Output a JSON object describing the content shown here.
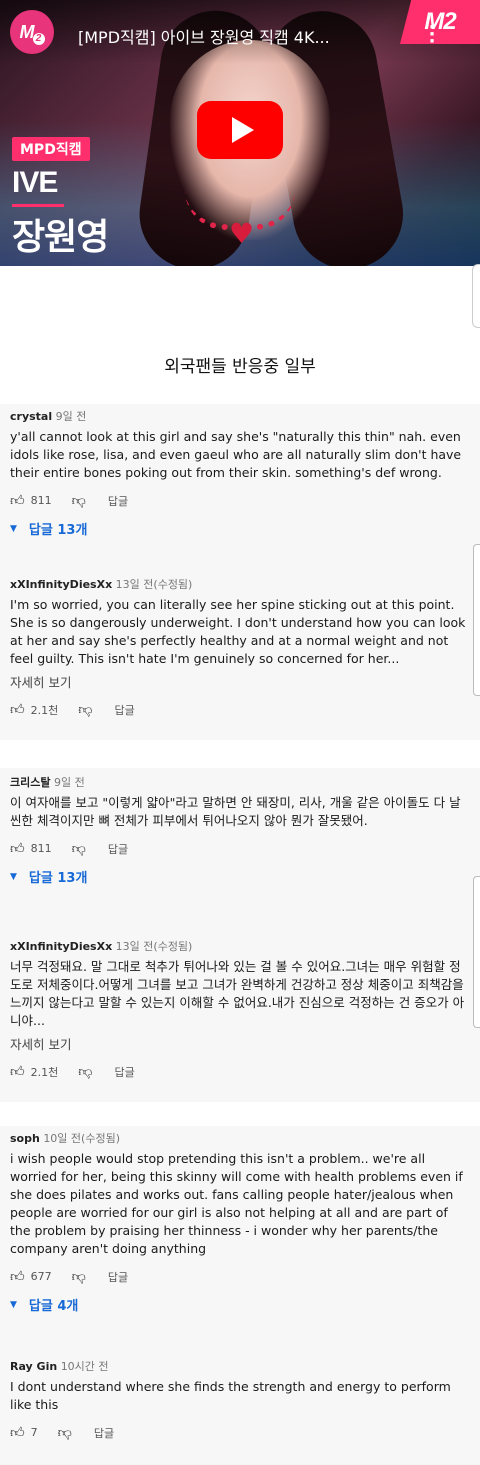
{
  "video": {
    "title": "[MPD직캠] 아이브 장원영 직캠 4K...",
    "channel_logo_text": "M",
    "channel_logo_sub": "2",
    "corner_logo": "M2",
    "badge": "MPD직캠",
    "group": "IVE",
    "member": "장원영"
  },
  "caption": "외국팬들 반응중 일부",
  "comments": [
    {
      "author": "crystal",
      "time": "9일 전",
      "text": "y'all cannot look at this girl and say she's \"naturally this thin\" nah. even idols like rose, lisa, and even gaeul who are all naturally slim don't have their entire bones poking out from their skin. something's def wrong.",
      "likes": "811",
      "reply_label": "답글",
      "replies": "답글 13개"
    },
    {
      "author": "xXInfinityDiesXx",
      "time": "13일 전(수정됨)",
      "text": "I'm so worried, you can literally see her spine sticking out at this point. She is so dangerously underweight. I don't understand how you can look at her and say she's perfectly healthy and at a normal weight and not feel guilty. This isn't hate I'm genuinely so concerned for her...",
      "more": "자세히 보기",
      "likes": "2.1천",
      "reply_label": "답글"
    },
    {
      "author": "크리스탈",
      "time": "9일 전",
      "text": "이 여자애를 보고 \"이렇게 얇아\"라고 말하면 안 돼장미, 리사, 개울 같은 아이돌도 다 날씬한 체격이지만 뼈 전체가 피부에서 튀어나오지 않아 뭔가 잘못됐어.",
      "likes": "811",
      "reply_label": "답글",
      "replies": "답글 13개"
    },
    {
      "author": "xXInfinityDiesXx",
      "time": "13일 전(수정됨)",
      "text": "너무 걱정돼요. 말 그대로 척추가 튀어나와 있는 걸 볼 수 있어요.그녀는 매우 위험할 정도로 저체중이다.어떻게 그녀를 보고 그녀가 완벽하게 건강하고 정상 체중이고 죄책감을 느끼지 않는다고 말할 수 있는지 이해할 수 없어요.내가 진심으로 걱정하는 건 증오가 아니야...",
      "more": "자세히 보기",
      "likes": "2.1천",
      "reply_label": "답글"
    },
    {
      "author": "soph",
      "time": "10일 전(수정됨)",
      "text": "i wish people would stop pretending this isn't a problem.. we're all worried for her, being this skinny will come with health problems even if she does pilates and works out. fans calling people hater/jealous when people are worried for our girl is also not helping at all and are part of the problem by praising her thinness - i wonder why her parents/the company aren't doing anything",
      "likes": "677",
      "reply_label": "답글",
      "replies": "답글 4개"
    },
    {
      "author": "Ray Gin",
      "time": "10시간 전",
      "text": "I dont understand where she finds the strength and energy to perform like this",
      "likes": "7",
      "reply_label": "답글"
    }
  ]
}
